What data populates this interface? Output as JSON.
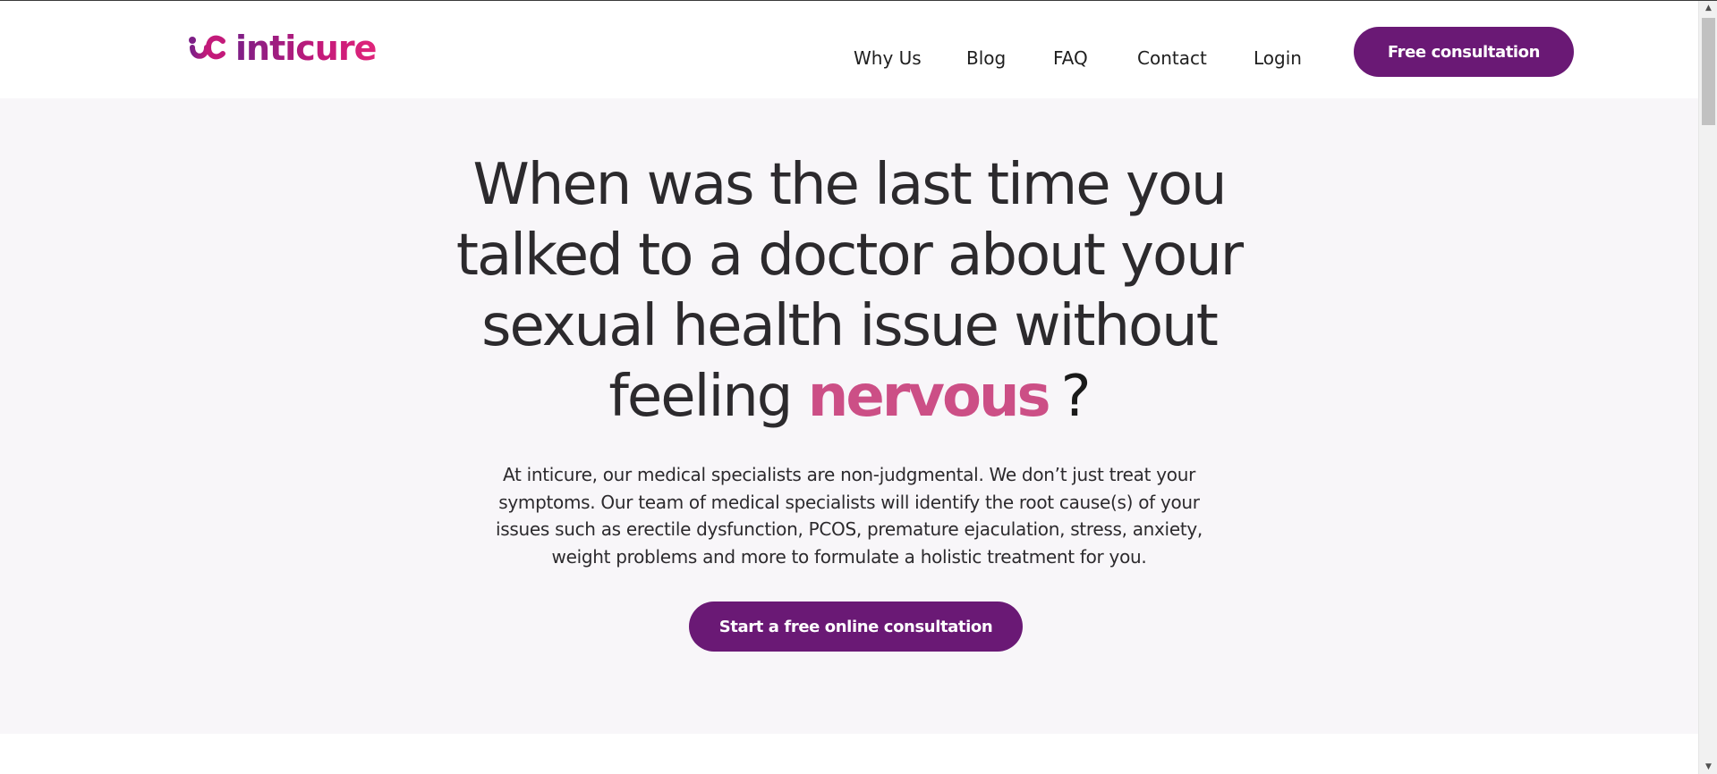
{
  "brand": {
    "name": "inticure",
    "logo_icon": "inticure-logo-mark",
    "gradient_start": "#7e1f86",
    "gradient_end": "#e0257a"
  },
  "nav": {
    "items": [
      {
        "label": "Why Us"
      },
      {
        "label": "Blog"
      },
      {
        "label": "FAQ"
      },
      {
        "label": "Contact"
      },
      {
        "label": "Login"
      }
    ],
    "cta_label": "Free consultation"
  },
  "hero": {
    "headline_lines": [
      "When was the last time you",
      "talked to a doctor about your",
      "sexual health issue without"
    ],
    "headline_last_prefix": "feeling",
    "headline_accent": "nervous",
    "headline_suffix": "?",
    "description": "At inticure, our medical specialists are non-judgmental. We don’t just treat your symptoms. Our team of medical specialists will identify the root cause(s) of your issues such as  erectile dysfunction, PCOS, premature ejaculation, stress, anxiety, weight problems and more to formulate a holistic treatment for you.",
    "cta_label": "Start a free online consultation"
  },
  "colors": {
    "primary": "#6a1975",
    "accent": "#cc4f86",
    "hero_bg": "#f8f6f9",
    "text": "#2c2a2d"
  }
}
